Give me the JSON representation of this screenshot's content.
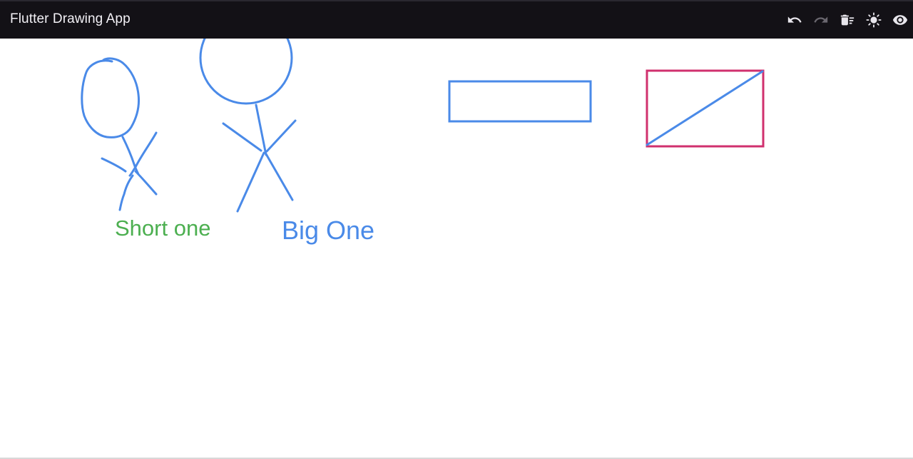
{
  "app_bar": {
    "title": "Flutter Drawing App",
    "background": "#131116",
    "actions": [
      {
        "name": "undo-icon",
        "icon": "undo",
        "enabled": true
      },
      {
        "name": "redo-icon",
        "icon": "redo",
        "enabled": false
      },
      {
        "name": "clear-all-icon",
        "icon": "delete-sweep",
        "enabled": true
      },
      {
        "name": "theme-toggle-icon",
        "icon": "brightness-sun",
        "enabled": true
      },
      {
        "name": "preview-icon",
        "icon": "eye",
        "enabled": true
      }
    ]
  },
  "canvas": {
    "background": "#ffffff",
    "stroke_blue": "#4a8ae8",
    "stroke_magenta": "#d0306e",
    "text_green": "#4caf50",
    "labels": {
      "short": "Short one",
      "big": "Big One"
    },
    "shapes": [
      {
        "kind": "freehand-stick-figure",
        "color": "blue"
      },
      {
        "kind": "circle-stick-figure",
        "color": "blue"
      },
      {
        "kind": "rectangle",
        "color": "blue"
      },
      {
        "kind": "rectangle",
        "color": "magenta"
      },
      {
        "kind": "line",
        "color": "blue"
      }
    ]
  }
}
